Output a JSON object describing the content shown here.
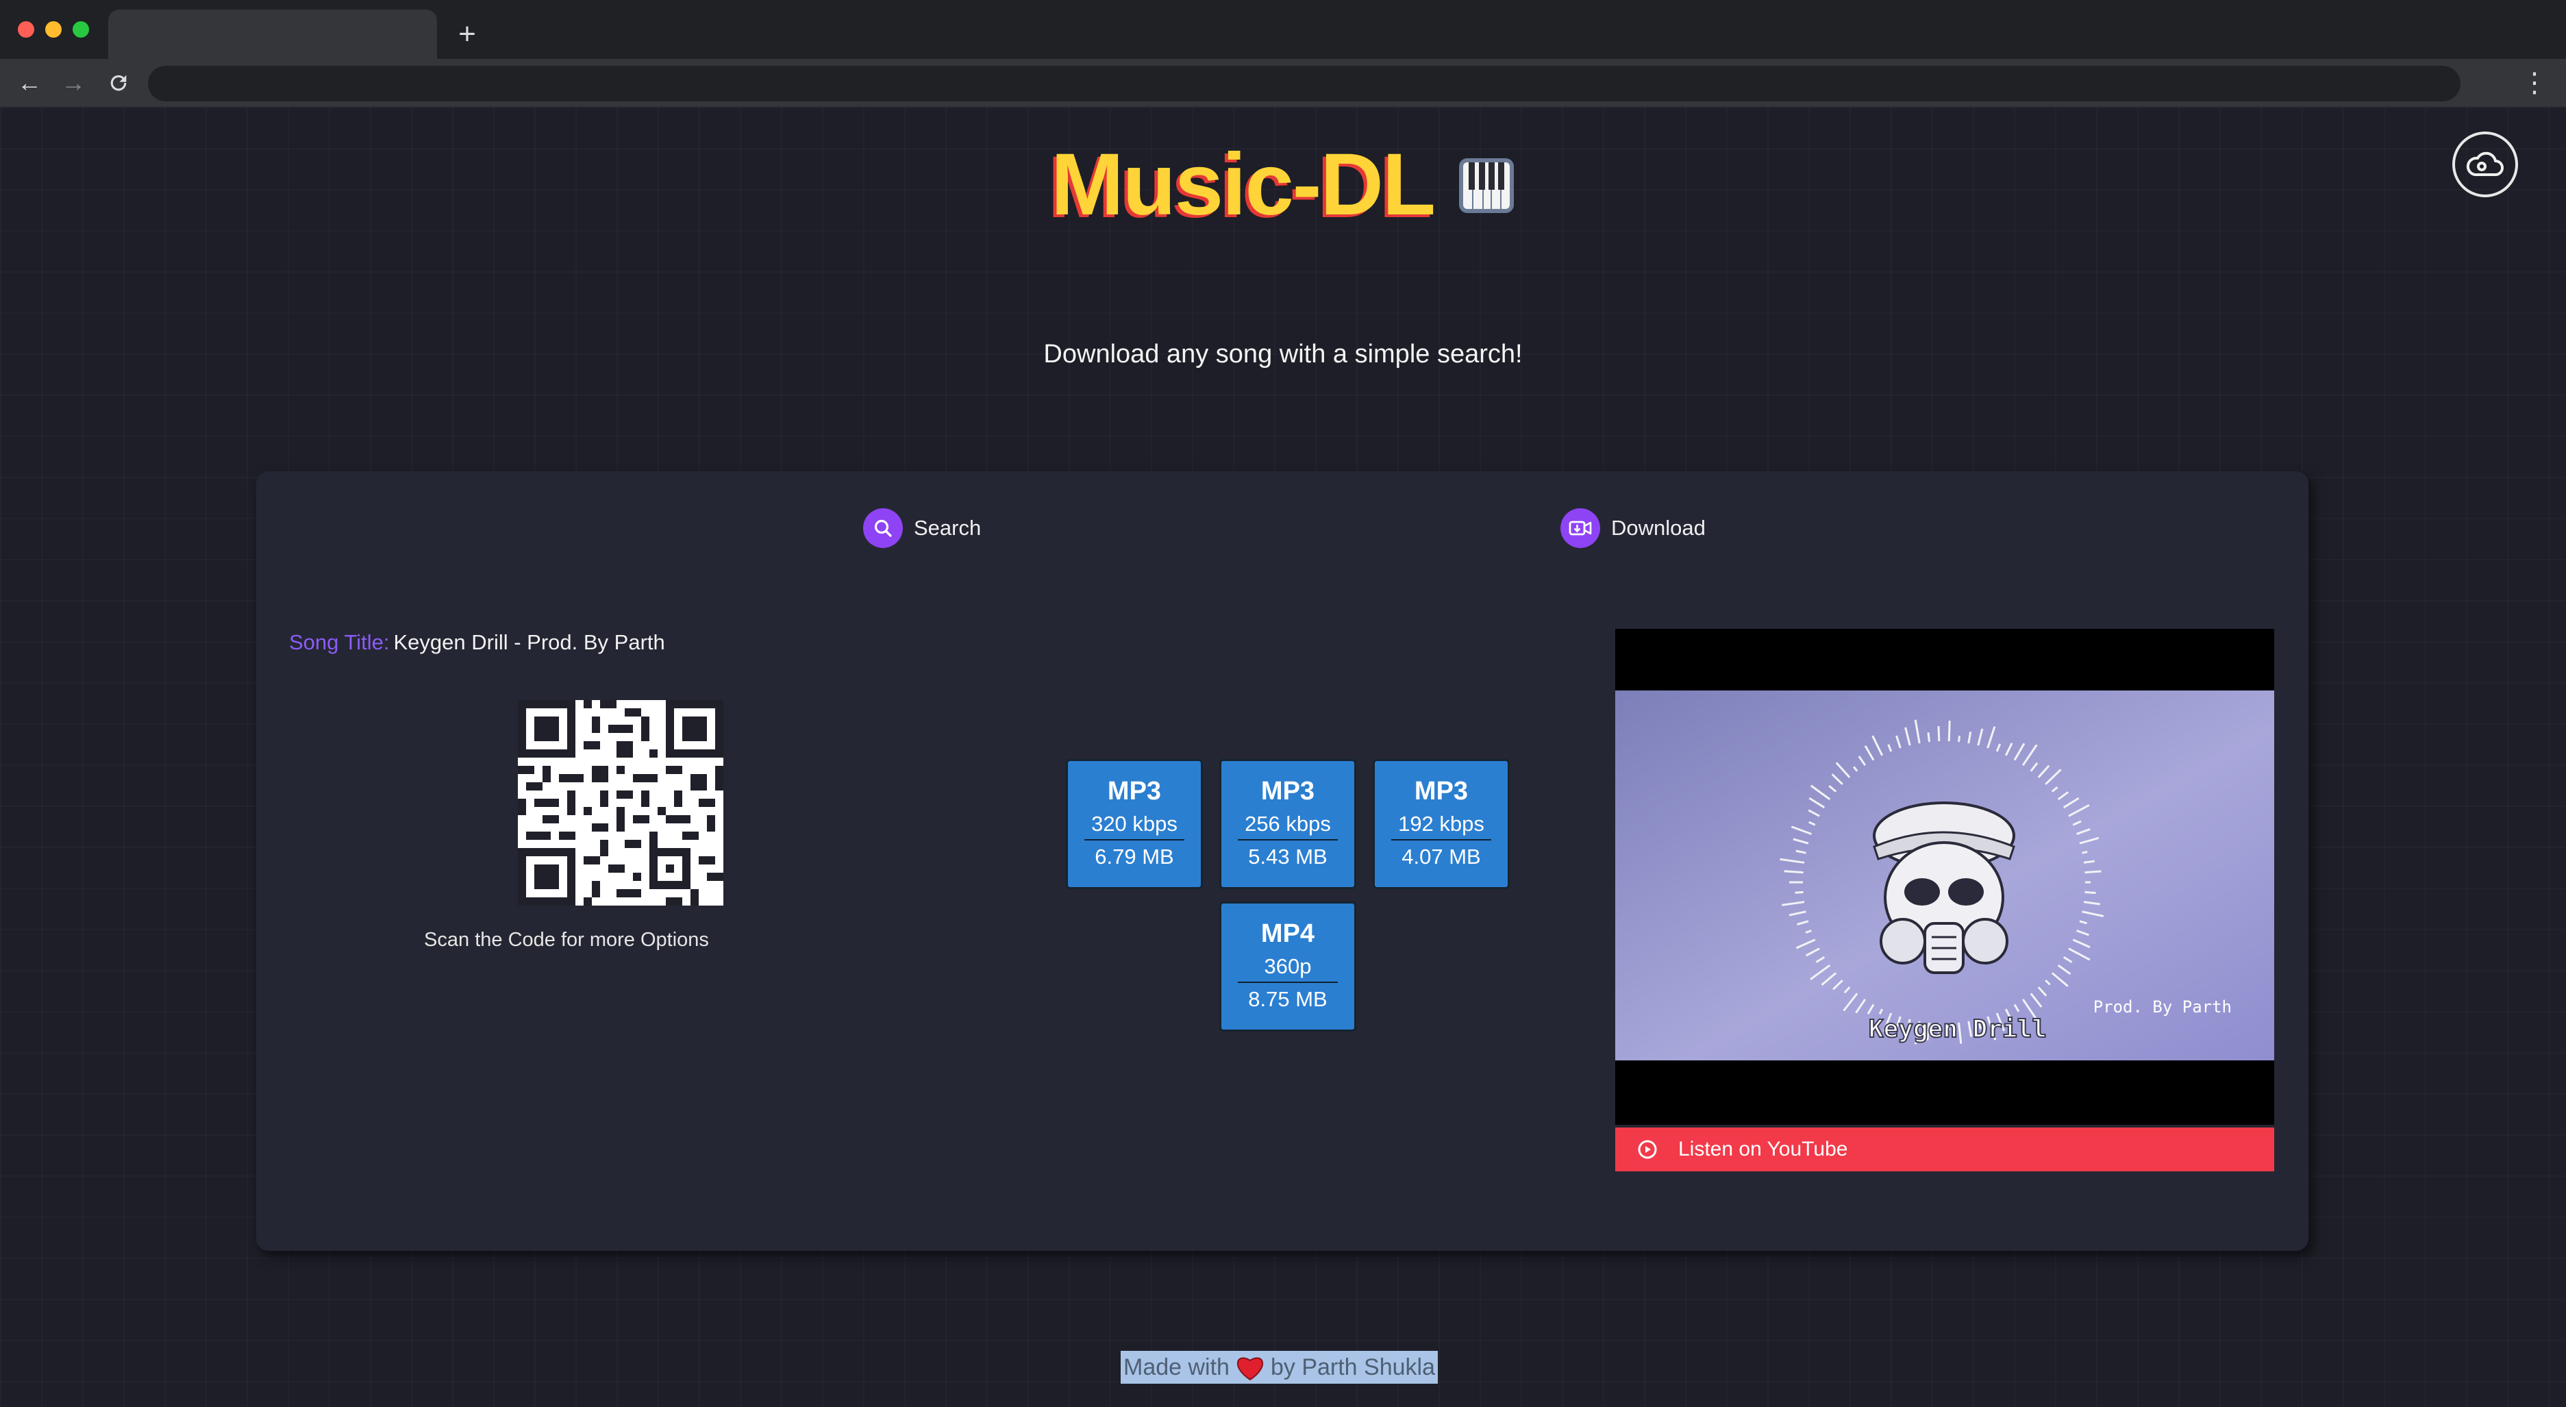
{
  "app": {
    "title": "Music-DL",
    "title_emoji": "piano-keys-icon",
    "subtitle": "Download any song with a simple search!"
  },
  "tabs": [
    {
      "label": "Search",
      "icon": "search-icon"
    },
    {
      "label": "Download",
      "icon": "video-download-icon"
    }
  ],
  "song": {
    "title_label": "Song Title:",
    "title_value": "Keygen Drill - Prod. By Parth"
  },
  "qr": {
    "caption": "Scan the Code for more Options"
  },
  "formats": [
    {
      "format": "MP3",
      "quality": "320 kbps",
      "size": "6.79 MB"
    },
    {
      "format": "MP3",
      "quality": "256 kbps",
      "size": "5.43 MB"
    },
    {
      "format": "MP3",
      "quality": "192 kbps",
      "size": "4.07 MB"
    },
    {
      "format": "MP4",
      "quality": "360p",
      "size": "8.75 MB"
    }
  ],
  "video": {
    "thumbnail_caption": "Keygen Drill",
    "thumbnail_credit": "Prod. By Parth",
    "youtube_label": "Listen on YouTube"
  },
  "footer": {
    "prefix": "Made with",
    "suffix": "by Parth Shukla"
  },
  "colors": {
    "background": "#1d1e27",
    "card": "#252633",
    "accent_purple": "#8e44f5",
    "title_yellow": "#ffd438",
    "title_shadow_red": "#e53935",
    "button_blue": "#2b7fd1",
    "youtube_red": "#f23a4a"
  }
}
